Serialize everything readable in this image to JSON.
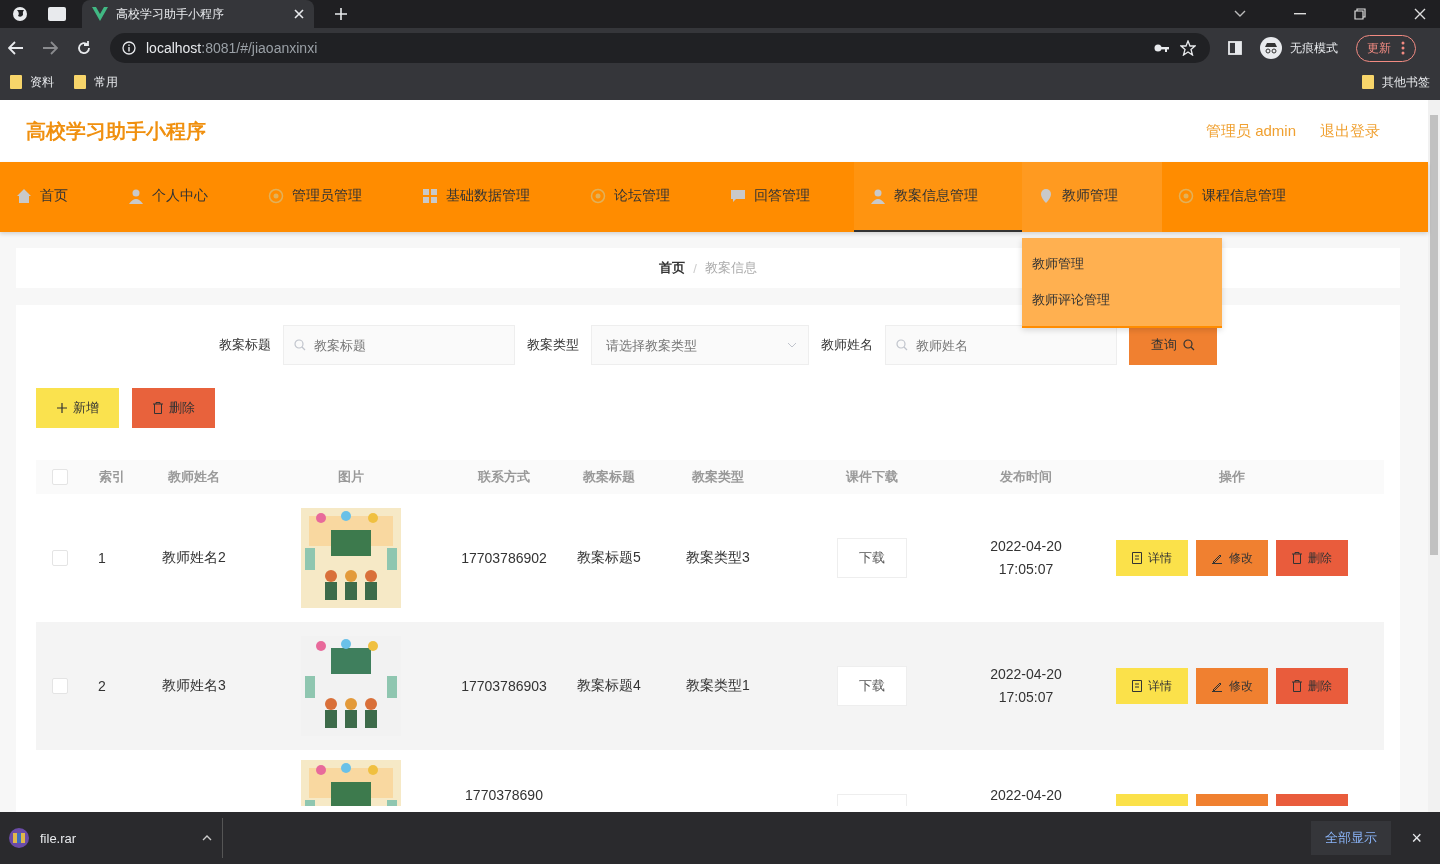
{
  "browser": {
    "tab_title": "高校学习助手小程序",
    "url_host": "localhost",
    "url_rest": ":8081/#/jiaoanxinxi",
    "incognito_label": "无痕模式",
    "update_label": "更新",
    "bookmarks": [
      "资料",
      "常用"
    ],
    "other_bookmarks": "其他书签"
  },
  "header": {
    "title": "高校学习助手小程序",
    "user": "管理员 admin",
    "logout": "退出登录"
  },
  "nav": [
    {
      "label": "首页",
      "selected": false
    },
    {
      "label": "个人中心",
      "selected": false
    },
    {
      "label": "管理员管理",
      "selected": false
    },
    {
      "label": "基础数据管理",
      "selected": false
    },
    {
      "label": "论坛管理",
      "selected": false
    },
    {
      "label": "回答管理",
      "selected": false
    },
    {
      "label": "教案信息管理",
      "selected": true
    },
    {
      "label": "教师管理",
      "selected": false,
      "expanded": true,
      "children": [
        "教师管理",
        "教师评论管理"
      ]
    },
    {
      "label": "课程信息管理",
      "selected": false
    }
  ],
  "breadcrumb": [
    "首页",
    "教案信息"
  ],
  "breadcrumb_separator": "/",
  "search": {
    "fields": [
      {
        "kind": "text",
        "label": "教案标题",
        "placeholder": "教案标题"
      },
      {
        "kind": "select",
        "label": "教案类型",
        "placeholder": "请选择教案类型"
      },
      {
        "kind": "text",
        "label": "教师姓名",
        "placeholder": "教师姓名"
      }
    ],
    "button": "查询"
  },
  "toolbar": {
    "add": "新增",
    "delete": "删除"
  },
  "table": {
    "all_checked": false,
    "columns": [
      "索引",
      "教师姓名",
      "图片",
      "联系方式",
      "教案标题",
      "教案类型",
      "课件下载",
      "发布时间",
      "操作"
    ],
    "rows": [
      {
        "checked": false,
        "index": "1",
        "teacher": "教师姓名2",
        "contact": "17703786902",
        "title": "教案标题5",
        "type": "教案类型3",
        "download": "下载",
        "time": "2022-04-20 17:05:07",
        "actions": [
          "详情",
          "修改",
          "删除"
        ]
      },
      {
        "checked": false,
        "index": "2",
        "teacher": "教师姓名3",
        "contact": "17703786903",
        "title": "教案标题4",
        "type": "教案类型1",
        "download": "下载",
        "time": "2022-04-20 17:05:07",
        "actions": [
          "详情",
          "修改",
          "删除"
        ]
      },
      {
        "contact": "1770378690",
        "time": "2022-04-20"
      }
    ]
  },
  "download_bar": {
    "file": "file.rar",
    "show_all": "全部显示",
    "close": "×"
  }
}
